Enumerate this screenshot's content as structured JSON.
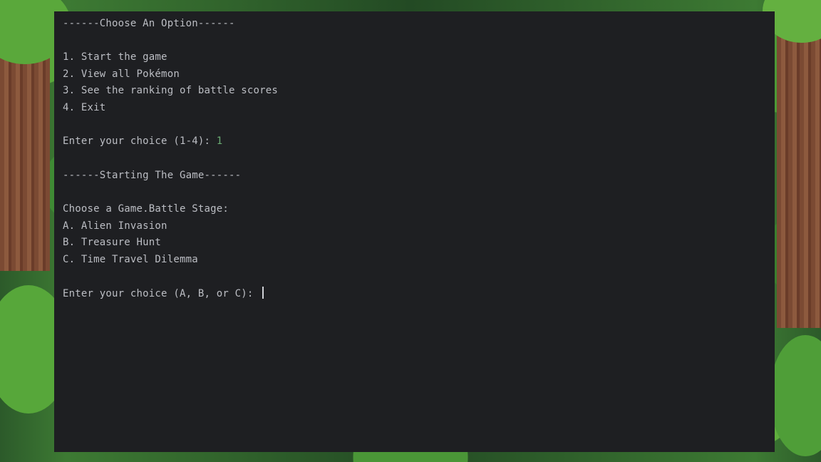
{
  "terminal": {
    "menu_header": "------Choose An Option------",
    "menu_options": [
      "1. Start the game",
      "2. View all Pokémon",
      "3. See the ranking of battle scores",
      "4. Exit"
    ],
    "choice_prompt": "Enter your choice (1-4): ",
    "choice_value": "1",
    "start_header": "------Starting The Game------",
    "stage_prompt": "Choose a Game.Battle Stage:",
    "stage_options": [
      "A. Alien Invasion",
      "B. Treasure Hunt",
      "C. Time Travel Dilemma"
    ],
    "stage_choice_prompt": "Enter your choice (A, B, or C): ",
    "stage_choice_value": ""
  },
  "colors": {
    "terminal_bg": "#1e1f22",
    "text": "#bcbec4",
    "input_value": "#6aab73"
  }
}
